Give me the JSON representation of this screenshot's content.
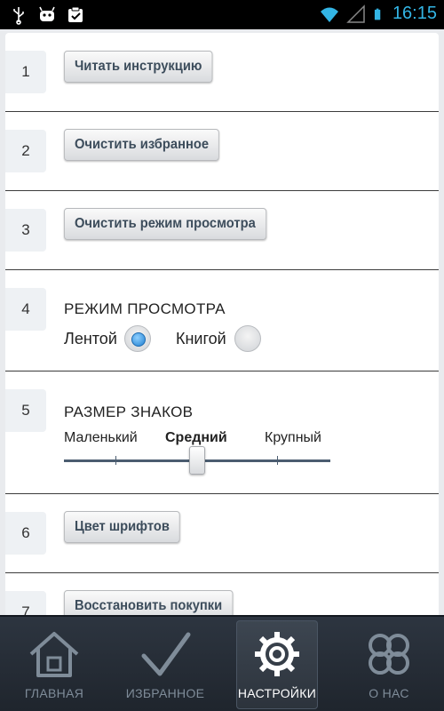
{
  "status_bar": {
    "time": "16:15",
    "icons": [
      "usb-icon",
      "android-debug-icon",
      "clipboard-check-icon",
      "wifi-icon",
      "signal-icon",
      "battery-icon"
    ]
  },
  "settings": [
    {
      "number": "1",
      "button_label": "Читать инструкцию"
    },
    {
      "number": "2",
      "button_label": "Очистить избранное"
    },
    {
      "number": "3",
      "button_label": "Очистить режим просмотра"
    },
    {
      "number": "4",
      "title": "РЕЖИМ ПРОСМОТРА",
      "options": [
        {
          "label": "Лентой",
          "selected": true
        },
        {
          "label": "Книгой",
          "selected": false
        }
      ]
    },
    {
      "number": "5",
      "title": "РАЗМЕР ЗНАКОВ",
      "levels": [
        "Маленький",
        "Средний",
        "Крупный"
      ],
      "selected_level": "Средний",
      "slider_value_fraction": 0.5
    },
    {
      "number": "6",
      "button_label": "Цвет шрифтов"
    },
    {
      "number": "7",
      "button_label": "Восстановить покупки"
    }
  ],
  "tabs": [
    {
      "label": "ГЛАВНАЯ",
      "icon": "home-icon",
      "active": false
    },
    {
      "label": "ИЗБРАННОЕ",
      "icon": "checkmark-icon",
      "active": false
    },
    {
      "label": "НАСТРОЙКИ",
      "icon": "gear-icon",
      "active": true
    },
    {
      "label": "О НАС",
      "icon": "clover-icon",
      "active": false
    }
  ],
  "colors": {
    "status_time": "#33b5e5",
    "tabbar_bg": "#2d3540",
    "radio_selected": "#1f7fd1",
    "slider_track": "#4b5d70"
  }
}
